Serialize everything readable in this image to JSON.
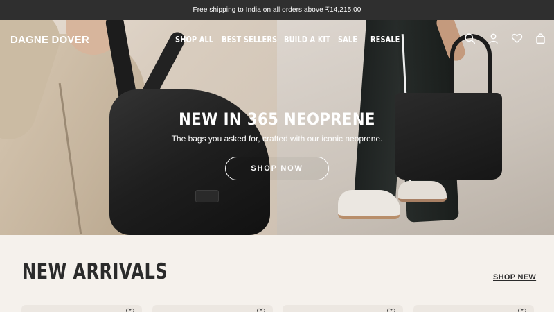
{
  "announcement": "Free shipping to India on all orders above ₹14,215.00",
  "header": {
    "logo": "DAGNE DOVER",
    "nav": [
      "SHOP ALL",
      "BEST SELLERS",
      "BUILD A KIT",
      "SALE",
      "RESALE"
    ],
    "icons": [
      "search-icon",
      "account-icon",
      "wishlist-heart-icon",
      "cart-bag-icon"
    ]
  },
  "hero": {
    "title": "NEW IN 365 NEOPRENE",
    "subtitle": "The bags you asked for, crafted with our iconic neoprene.",
    "cta": "SHOP NOW"
  },
  "arrivals": {
    "title": "NEW ARRIVALS",
    "link": "SHOP NEW"
  },
  "colors": {
    "announcement_bg": "#2f2f2f",
    "page_bg": "#f5f1ec",
    "text_dark": "#2b2b2b"
  }
}
